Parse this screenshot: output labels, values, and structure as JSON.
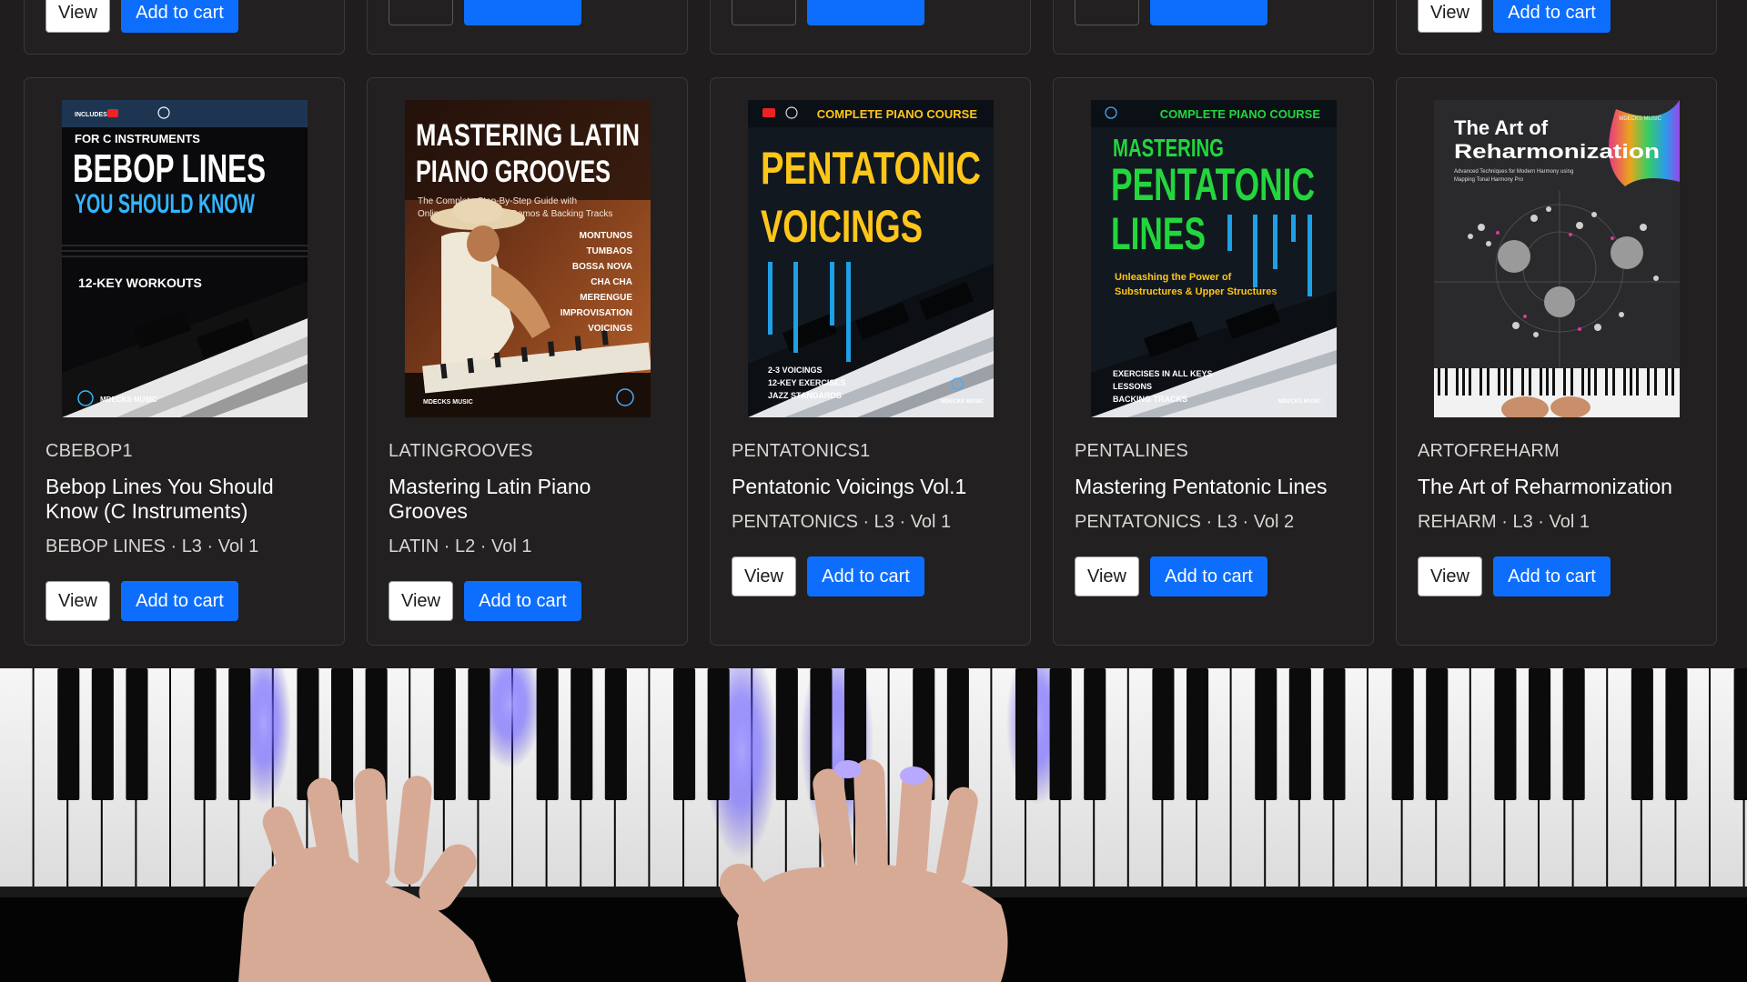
{
  "top_row": [
    {
      "view_label": "View",
      "cart_label": "Add to cart"
    },
    {
      "view_label": "",
      "cart_label": ""
    },
    {
      "view_label": "",
      "cart_label": ""
    },
    {
      "view_label": "",
      "cart_label": ""
    },
    {
      "view_label": "View",
      "cart_label": "Add to cart"
    }
  ],
  "products": [
    {
      "sku": "CBEBOP1",
      "title": "Bebop Lines You Should Know (C Instruments)",
      "meta": "BEBOP LINES · L3 · Vol 1",
      "view_label": "View",
      "cart_label": "Add to cart",
      "cover": {
        "badge": "INCLUDES",
        "kicker": "FOR C INSTRUMENTS",
        "line1": "BEBOP LINES",
        "line2": "YOU SHOULD KNOW",
        "tagline": "12-KEY WORKOUTS",
        "publisher": "MDECKS MUSIC",
        "accent": "#33b6ff"
      }
    },
    {
      "sku": "LATINGROOVES",
      "title": "Mastering Latin Piano Grooves",
      "meta": "LATIN · L2 · Vol 1",
      "view_label": "View",
      "cart_label": "Add to cart",
      "cover": {
        "line1": "MASTERING LATIN",
        "line2": "PIANO GROOVES",
        "sub1": "The Complete Step-By-Step Guide with",
        "sub2": "Online Video Lessons, Demos & Backing Tracks",
        "list": [
          "MONTUNOS",
          "TUMBAOS",
          "BOSSA NOVA",
          "CHA CHA",
          "MERENGUE",
          "IMPROVISATION",
          "VOICINGS"
        ],
        "publisher": "MDECKS MUSIC"
      }
    },
    {
      "sku": "PENTATONICS1",
      "title": "Pentatonic Voicings Vol.1",
      "meta": "PENTATONICS · L3 · Vol 1",
      "view_label": "View",
      "cart_label": "Add to cart",
      "cover": {
        "kicker": "COMPLETE PIANO COURSE",
        "line1": "PENTATONIC",
        "line2": "VOICINGS",
        "list": [
          "2-3 VOICINGS",
          "12-KEY EXERCISES",
          "JAZZ STANDARDS"
        ],
        "publisher": "MDECKS MUSIC",
        "accent": "#ffc61a"
      }
    },
    {
      "sku": "PENTALINES",
      "title": "Mastering Pentatonic Lines",
      "meta": "PENTATONICS · L3 · Vol 2",
      "view_label": "View",
      "cart_label": "Add to cart",
      "cover": {
        "kicker": "COMPLETE PIANO COURSE",
        "line1": "MASTERING",
        "line2": "PENTATONIC",
        "line3": "LINES",
        "sub1": "Unleashing the Power of",
        "sub2": "Substructures & Upper Structures",
        "list": [
          "EXERCISES IN ALL KEYS",
          "LESSONS",
          "BACKING TRACKS"
        ],
        "publisher": "MDECKS MUSIC",
        "accent": "#22d63c"
      }
    },
    {
      "sku": "ARTOFREHARM",
      "title": "The Art of Reharmonization",
      "meta": "REHARM · L3 · Vol 1",
      "view_label": "View",
      "cart_label": "Add to cart",
      "cover": {
        "line1": "The Art of",
        "line2": "Reharmonization",
        "sub1": "Advanced Techniques for Modern Harmony using",
        "sub2": "Mapping Tonal Harmony Pro",
        "publisher": "MDECKS MUSIC"
      }
    }
  ]
}
